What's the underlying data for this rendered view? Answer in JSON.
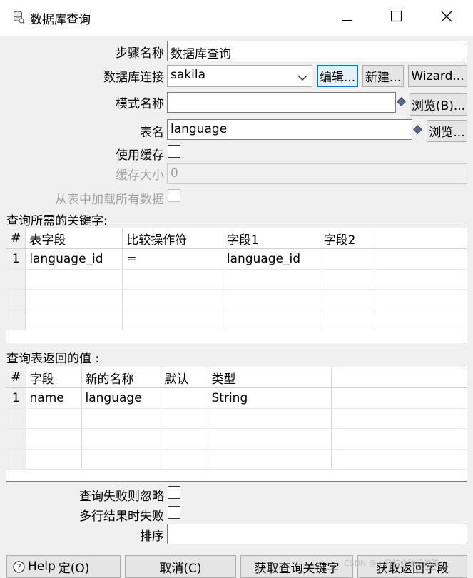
{
  "window": {
    "title": "数据库查询"
  },
  "form": {
    "step_name_label": "步骤名称",
    "step_name_value": "数据库查询",
    "connection_label": "数据库连接",
    "connection_value": "sakila",
    "edit_button": "编辑...",
    "new_button": "新建...",
    "wizard_button": "Wizard...",
    "schema_label": "模式名称",
    "schema_value": "",
    "browse_schema_button": "浏览(B)...",
    "table_label": "表名",
    "table_value": "language",
    "browse_table_button": "浏览...",
    "use_cache_label": "使用缓存",
    "cache_size_label": "缓存大小",
    "cache_size_value": "0",
    "load_all_label": "从表中加载所有数据"
  },
  "keys_section": {
    "title": "查询所需的关键字:",
    "headers": [
      "#",
      "表字段",
      "比较操作符",
      "字段1",
      "字段2"
    ],
    "rows": [
      [
        "1",
        "language_id",
        "=",
        "language_id",
        ""
      ]
    ]
  },
  "values_section": {
    "title": "查询表返回的值 :",
    "headers": [
      "#",
      "字段",
      "新的名称",
      "默认",
      "类型"
    ],
    "rows": [
      [
        "1",
        "name",
        "language",
        "",
        "String"
      ]
    ]
  },
  "options": {
    "fail_ignore_label": "查询失败则忽略",
    "multi_fail_label": "多行结果时失败",
    "order_label": "排序",
    "order_value": ""
  },
  "footer": {
    "help_button": "Help",
    "ok_button_partial": "定(O)",
    "cancel_button": "取消(C)",
    "get_keys_button": "获取查询关键字",
    "get_fields_button": "获取返回字段"
  },
  "watermark": "CSDN @一只特立独行的陈"
}
